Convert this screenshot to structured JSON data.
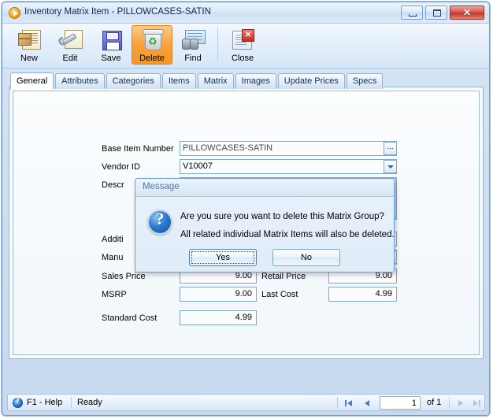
{
  "window": {
    "title": "Inventory Matrix Item - PILLOWCASES-SATIN",
    "icon": "app-play-icon",
    "controls": {
      "minimize": "minimize-icon",
      "maximize": "maximize-icon",
      "close": "✕"
    }
  },
  "toolbar": {
    "buttons": [
      {
        "label": "New",
        "icon": "new-item-icon",
        "active": false
      },
      {
        "label": "Edit",
        "icon": "edit-wrench-icon",
        "active": false
      },
      {
        "label": "Save",
        "icon": "save-floppy-icon",
        "active": false
      },
      {
        "label": "Delete",
        "icon": "delete-bin-icon",
        "active": true
      },
      {
        "label": "Find",
        "icon": "find-binoculars-icon",
        "active": false
      },
      {
        "label": "Close",
        "icon": "close-document-icon",
        "active": false
      }
    ]
  },
  "tabs": [
    {
      "label": "General",
      "selected": true
    },
    {
      "label": "Attributes",
      "selected": false
    },
    {
      "label": "Categories",
      "selected": false
    },
    {
      "label": "Items",
      "selected": false
    },
    {
      "label": "Matrix",
      "selected": false
    },
    {
      "label": "Images",
      "selected": false
    },
    {
      "label": "Update Prices",
      "selected": false
    },
    {
      "label": "Specs",
      "selected": false
    }
  ],
  "form": {
    "base_item_number": {
      "label": "Base Item Number",
      "value": "PILLOWCASES-SATIN",
      "browse_button": "..."
    },
    "vendor_id": {
      "label": "Vendor ID",
      "value": "V10007"
    },
    "description": {
      "label": "Descr",
      "value": ""
    },
    "additional": {
      "label": "Additi",
      "value": ""
    },
    "manufacturer": {
      "label": "Manu",
      "value": ""
    },
    "sales_price": {
      "label": "Sales Price",
      "value": "9.00"
    },
    "retail_price": {
      "label": "Retail Price",
      "value": "9.00"
    },
    "msrp": {
      "label": "MSRP",
      "value": "9.00"
    },
    "last_cost": {
      "label": "Last Cost",
      "value": "4.99"
    },
    "standard_cost": {
      "label": "Standard Cost",
      "value": "4.99"
    }
  },
  "dialog": {
    "title": "Message",
    "icon": "question-mark-icon",
    "line1": "Are you sure you want to delete this Matrix Group?",
    "line2": "All related individual Matrix Items will also be deleted.",
    "yes_label": "Yes",
    "no_label": "No"
  },
  "statusbar": {
    "help_icon": "help-question-icon",
    "help_text": "F1 - Help",
    "status_text": "Ready",
    "first_icon": "first-record-icon",
    "prev_icon": "previous-record-icon",
    "page_value": "1",
    "of_text": "of 1",
    "next_icon": "next-record-icon",
    "last_icon": "last-record-icon"
  },
  "colors": {
    "accent_orange": "#f59525",
    "frame_blue": "#6f9ccb",
    "close_red": "#bb3a2e",
    "panel_bg": "#f7fbfd"
  }
}
